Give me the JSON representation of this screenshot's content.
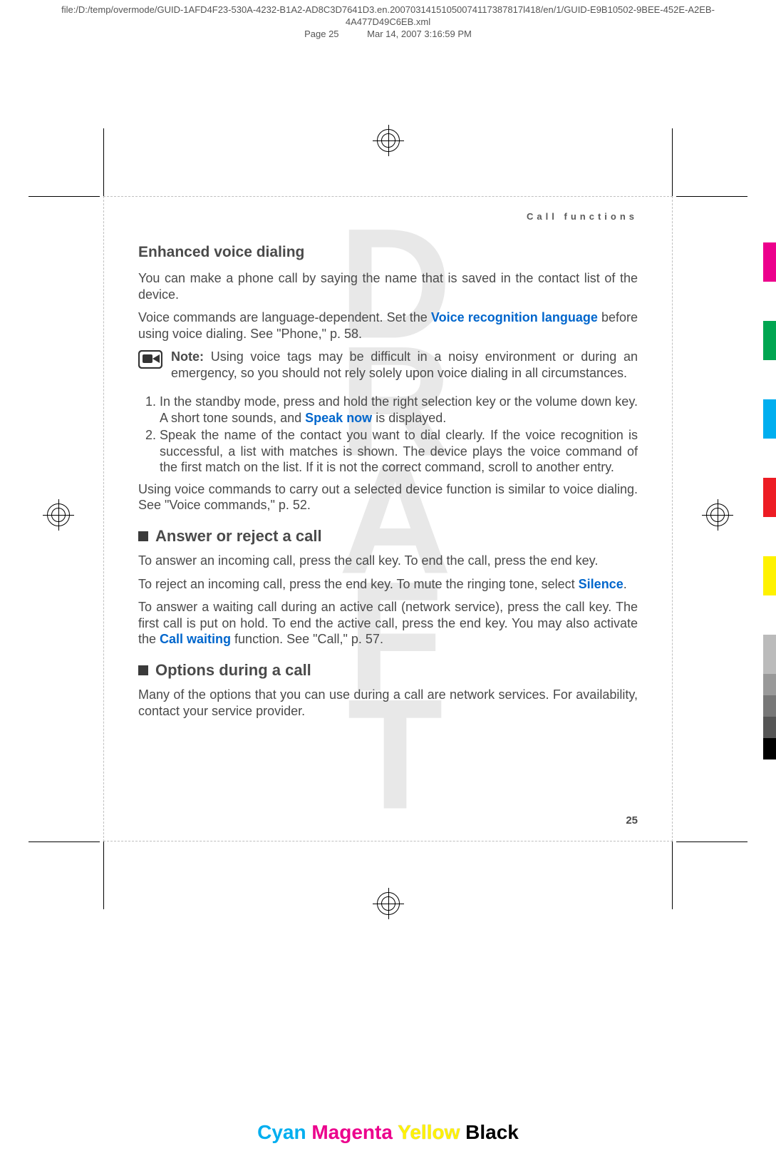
{
  "meta": {
    "path": "file:/D:/temp/overmode/GUID-1AFD4F23-530A-4232-B1A2-AD8C3D7641D3.en.20070314151050074117387817l418/en/1/GUID-E9B10502-9BEE-452E-A2EB-4A477D49C6EB.xml",
    "pagelabel": "Page 25",
    "timestamp": "Mar 14, 2007 3:16:59 PM"
  },
  "watermark": "DRAFT",
  "runhead": "Call functions",
  "sec_evd": {
    "title": "Enhanced voice dialing",
    "p1": "You can make a phone call by saying the name that is saved in the contact list of the device.",
    "p2a": "Voice commands are language-dependent. Set the ",
    "p2hl": "Voice recognition language",
    "p2b": " before using voice dialing. See \"Phone,\" p. 58.",
    "note_label": "Note:  ",
    "note_body": "Using voice tags may be difficult in a noisy environment or during an emergency, so you should not rely solely upon voice dialing in all circumstances.",
    "step1a": "In the standby mode, press and hold the right selection key or the volume down key. A short tone sounds, and ",
    "step1hl": "Speak now",
    "step1b": " is displayed.",
    "step2": "Speak the name of the contact you want to dial clearly. If the voice recognition is successful, a list with matches is shown. The device plays the voice command of the first match on the list. If it is not the correct command, scroll to another entry.",
    "p3": "Using voice commands to carry out a selected device function is similar to voice dialing. See \"Voice commands,\" p. 52."
  },
  "sec_answer": {
    "title": "Answer or reject a call",
    "p1": "To answer an incoming call, press the call key. To end the call, press the end key.",
    "p2a": "To reject an incoming call, press the end key. To mute the ringing tone, select ",
    "p2hl": "Silence",
    "p2b": ".",
    "p3a": "To answer a waiting call during an active call (network service), press the call key. The first call is put on hold. To end the active call, press the end key. You may also activate the ",
    "p3hl": "Call waiting",
    "p3b": " function. See \"Call,\" p. 57."
  },
  "sec_options": {
    "title": "Options during a call",
    "p1": "Many of the options that you can use during a call are network services. For availability, contact your service provider."
  },
  "pagenum": "25",
  "footer": {
    "c": "Cyan",
    "m": "Magenta",
    "y": "Yellow",
    "k": "Black"
  }
}
